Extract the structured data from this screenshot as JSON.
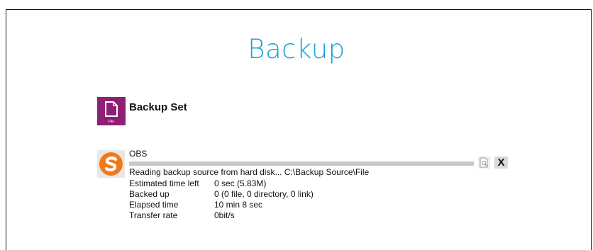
{
  "page": {
    "title": "Backup"
  },
  "backup_set": {
    "title": "Backup Set",
    "icon": "file-icon",
    "icon_label": "File",
    "icon_color": "#8f1f73"
  },
  "job": {
    "name": "OBS",
    "icon": "obs-logo-icon",
    "progress": 1.0,
    "status": "Reading backup source from hard disk... C:\\Backup Source\\File",
    "details": [
      {
        "label": "Estimated time left",
        "value": "0 sec (5.83M)"
      },
      {
        "label": "Backed up",
        "value": "0 (0 file, 0 directory, 0 link)"
      },
      {
        "label": "Elapsed time",
        "value": "10 min 8 sec"
      },
      {
        "label": "Transfer rate",
        "value": "0bit/s"
      }
    ],
    "stop_label": "X",
    "detail_icon": "magnify-document-icon"
  },
  "colors": {
    "title": "#1aa3d6",
    "obs_orange": "#f07a1b"
  }
}
